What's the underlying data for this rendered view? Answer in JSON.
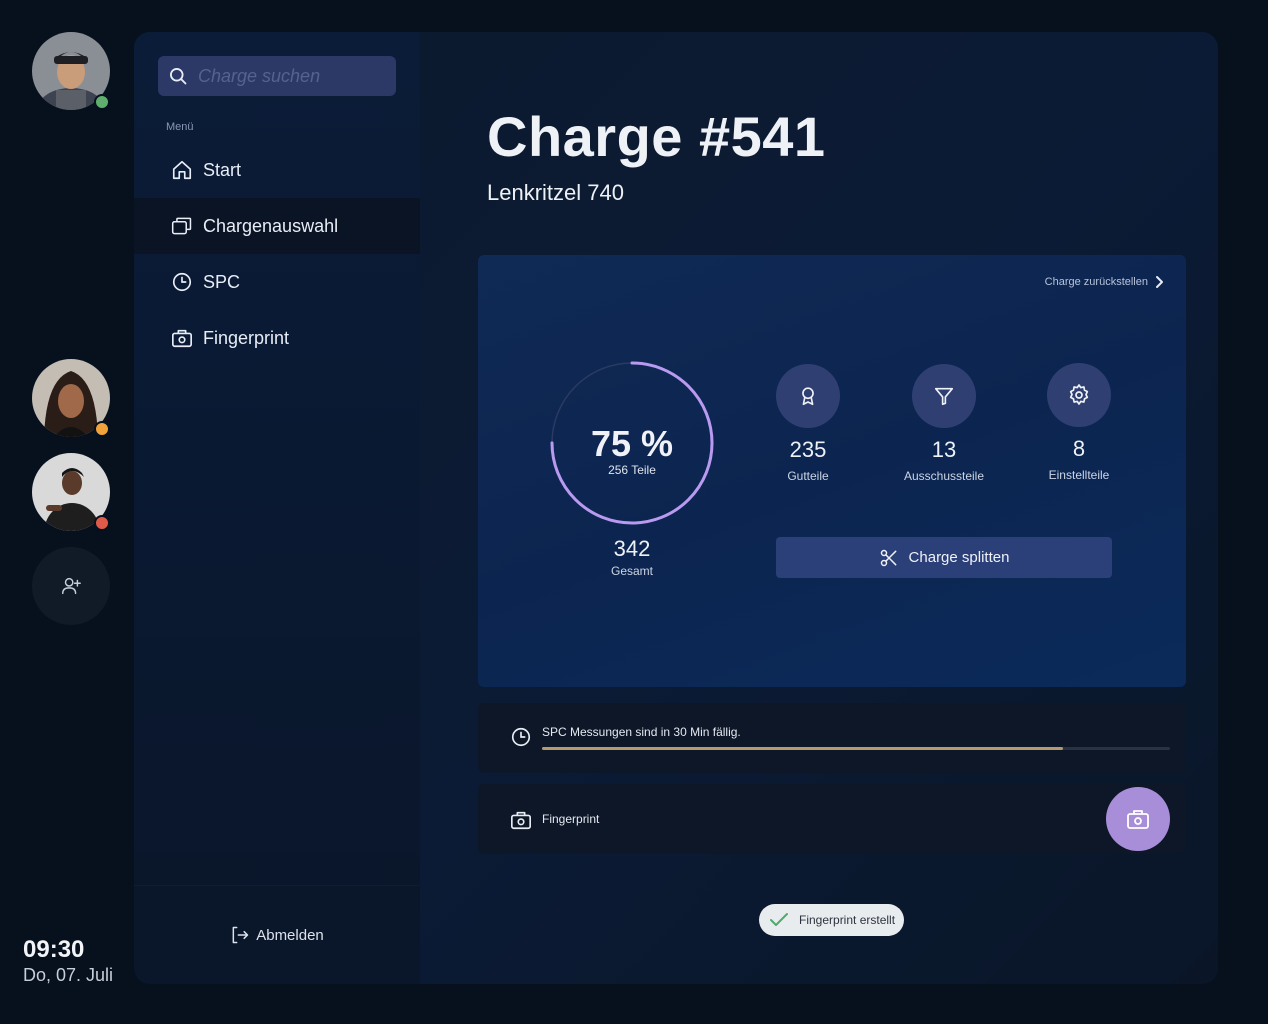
{
  "users": [
    {
      "name": "user-1",
      "status": "online",
      "status_color": "#5fae6d"
    },
    {
      "name": "user-2",
      "status": "away",
      "status_color": "#f2a23a"
    },
    {
      "name": "user-3",
      "status": "busy",
      "status_color": "#e05a4a"
    }
  ],
  "clock": {
    "time": "09:30",
    "date": "Do, 07. Juli"
  },
  "search": {
    "placeholder": "Charge suchen"
  },
  "sidebar": {
    "menu_title": "Menü",
    "items": [
      {
        "label": "Start",
        "icon": "home-icon"
      },
      {
        "label": "Chargenauswahl",
        "icon": "windows-icon",
        "active": true
      },
      {
        "label": "SPC",
        "icon": "clock-icon"
      },
      {
        "label": "Fingerprint",
        "icon": "camera-icon"
      }
    ],
    "logout_label": "Abmelden"
  },
  "header": {
    "title": "Charge #541",
    "subtitle": "Lenkritzel 740"
  },
  "card": {
    "reset_label": "Charge zurückstellen",
    "progress": {
      "percent_label": "75 %",
      "percent": 75,
      "parts_label": "256 Teile"
    },
    "total": {
      "value": "342",
      "label": "Gesamt"
    },
    "stats": [
      {
        "value": "235",
        "label": "Gutteile",
        "icon": "award-icon"
      },
      {
        "value": "13",
        "label": "Ausschussteile",
        "icon": "filter-icon"
      },
      {
        "value": "8",
        "label": "Einstellteile",
        "icon": "gear-icon"
      }
    ],
    "split_label": "Charge splitten"
  },
  "spc": {
    "message": "SPC Messungen sind in 30 Min fällig.",
    "progress": 0.83
  },
  "fingerprint": {
    "label": "Fingerprint"
  },
  "toast": {
    "message": "Fingerprint erstellt"
  },
  "colors": {
    "accent": "#a88ed8",
    "ring": "#b99af0",
    "progress_fill": "#b49b6f",
    "button": "#2b3f78"
  }
}
